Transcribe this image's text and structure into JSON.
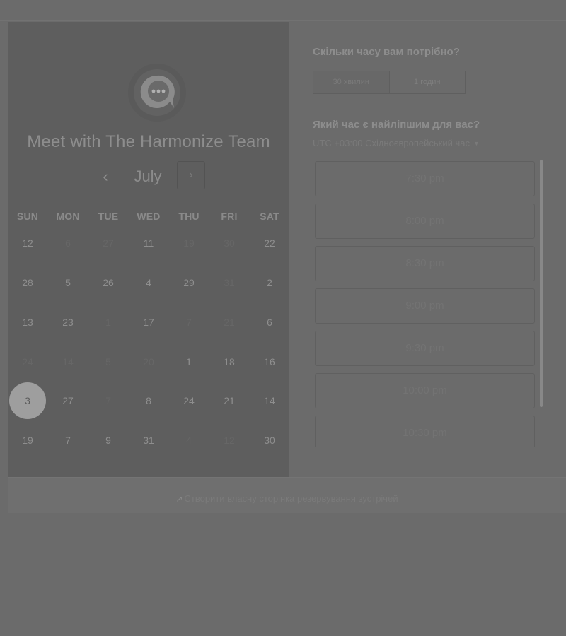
{
  "calendar": {
    "title": "Meet with The Harmonize Team",
    "month": "July",
    "prev_label": "‹",
    "next_label": "›",
    "weekdays": [
      "SUN",
      "MON",
      "TUE",
      "WED",
      "THU",
      "FRI",
      "SAT"
    ],
    "weeks": [
      [
        {
          "d": "12",
          "s": "active"
        },
        {
          "d": "6",
          "s": "muted"
        },
        {
          "d": "27",
          "s": "muted"
        },
        {
          "d": "11",
          "s": "active"
        },
        {
          "d": "19",
          "s": "muted"
        },
        {
          "d": "30",
          "s": "muted"
        },
        {
          "d": "22",
          "s": "active"
        }
      ],
      [
        {
          "d": "28",
          "s": "active"
        },
        {
          "d": "5",
          "s": "active"
        },
        {
          "d": "26",
          "s": "active"
        },
        {
          "d": "4",
          "s": "active"
        },
        {
          "d": "29",
          "s": "active"
        },
        {
          "d": "31",
          "s": "muted"
        },
        {
          "d": "2",
          "s": "active"
        }
      ],
      [
        {
          "d": "13",
          "s": "active"
        },
        {
          "d": "23",
          "s": "active"
        },
        {
          "d": "1",
          "s": "muted"
        },
        {
          "d": "17",
          "s": "active"
        },
        {
          "d": "7",
          "s": "muted"
        },
        {
          "d": "21",
          "s": "muted"
        },
        {
          "d": "6",
          "s": "active"
        }
      ],
      [
        {
          "d": "24",
          "s": "muted"
        },
        {
          "d": "14",
          "s": "muted"
        },
        {
          "d": "5",
          "s": "muted"
        },
        {
          "d": "20",
          "s": "muted"
        },
        {
          "d": "1",
          "s": "active"
        },
        {
          "d": "18",
          "s": "active"
        },
        {
          "d": "16",
          "s": "active"
        }
      ],
      [
        {
          "d": "3",
          "s": "selected"
        },
        {
          "d": "27",
          "s": "active"
        },
        {
          "d": "7",
          "s": "muted"
        },
        {
          "d": "8",
          "s": "active"
        },
        {
          "d": "24",
          "s": "active"
        },
        {
          "d": "21",
          "s": "active"
        },
        {
          "d": "14",
          "s": "active"
        }
      ],
      [
        {
          "d": "19",
          "s": "active"
        },
        {
          "d": "7",
          "s": "active"
        },
        {
          "d": "9",
          "s": "active"
        },
        {
          "d": "31",
          "s": "active"
        },
        {
          "d": "4",
          "s": "muted"
        },
        {
          "d": "12",
          "s": "muted"
        },
        {
          "d": "30",
          "s": "active"
        }
      ]
    ]
  },
  "booking": {
    "duration_question": "Скільки часу вам потрібно?",
    "durations": [
      {
        "label": "30 хвилин",
        "selected": true
      },
      {
        "label": "1 годин",
        "selected": false
      }
    ],
    "time_question": "Який час є найліпшим для вас?",
    "timezone": "UTC +03:00 Східноєвропейський час",
    "timezone_caret": "▼",
    "slots": [
      "7:30 pm",
      "8:00 pm",
      "8:30 pm",
      "9:00 pm",
      "9:30 pm",
      "10:00 pm",
      "10:30 pm"
    ]
  },
  "footer": {
    "icon": "↗",
    "icon_name": "external-link-icon",
    "link_text": "Створити власну сторінка резервування зустрічей"
  },
  "colors": {
    "background": "#6b6b6b",
    "calendar_panel": "#5e5e5e",
    "selected_day": "#9e9e9e"
  }
}
